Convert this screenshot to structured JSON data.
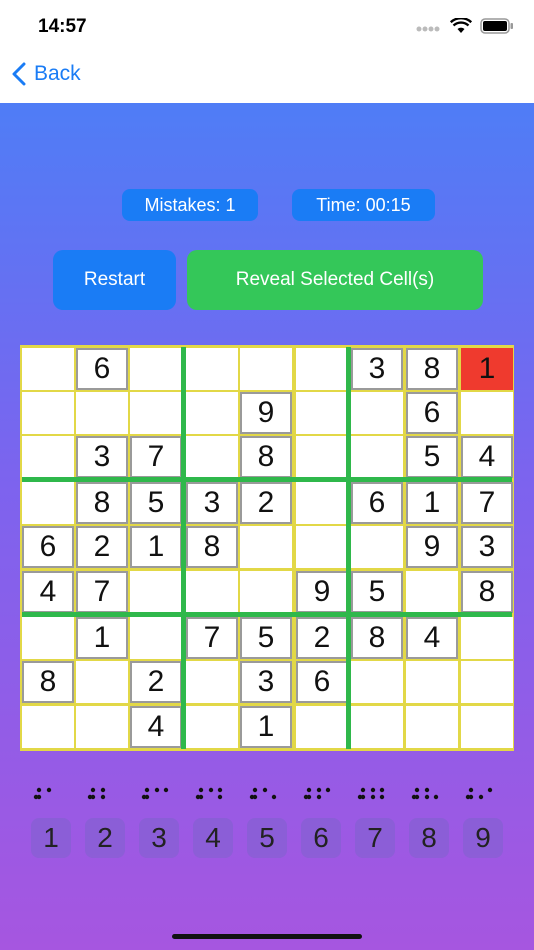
{
  "status": {
    "time": "14:57"
  },
  "nav": {
    "back_label": "Back"
  },
  "stats": {
    "mistakes": "Mistakes: 1",
    "time": "Time: 00:15"
  },
  "actions": {
    "restart": "Restart",
    "reveal": "Reveal Selected Cell(s)"
  },
  "colors": {
    "accent": "#1a7cf5",
    "reveal_green": "#34c759",
    "error_red": "#ef3a2e",
    "grid_green": "#2fb84b",
    "board_border": "#e2d847"
  },
  "board": [
    [
      "",
      "6",
      "",
      "",
      "",
      "",
      "3",
      "8",
      "1"
    ],
    [
      "",
      "",
      "",
      "",
      "9",
      "",
      "",
      "6",
      ""
    ],
    [
      "",
      "3",
      "7",
      "",
      "8",
      "",
      "",
      "5",
      "4"
    ],
    [
      "",
      "8",
      "5",
      "3",
      "2",
      "",
      "6",
      "1",
      "7"
    ],
    [
      "6",
      "2",
      "1",
      "8",
      "",
      "",
      "",
      "9",
      "3"
    ],
    [
      "4",
      "7",
      "",
      "",
      "",
      "9",
      "5",
      "",
      "8"
    ],
    [
      "",
      "1",
      "",
      "7",
      "5",
      "2",
      "8",
      "4",
      ""
    ],
    [
      "8",
      "",
      "2",
      "",
      "3",
      "6",
      "",
      "",
      ""
    ],
    [
      "",
      "",
      "4",
      "",
      "1",
      "",
      "",
      "",
      ""
    ]
  ],
  "error_cell": {
    "row": 0,
    "col": 8
  },
  "number_pad": [
    "1",
    "2",
    "3",
    "4",
    "5",
    "6",
    "7",
    "8",
    "9"
  ]
}
